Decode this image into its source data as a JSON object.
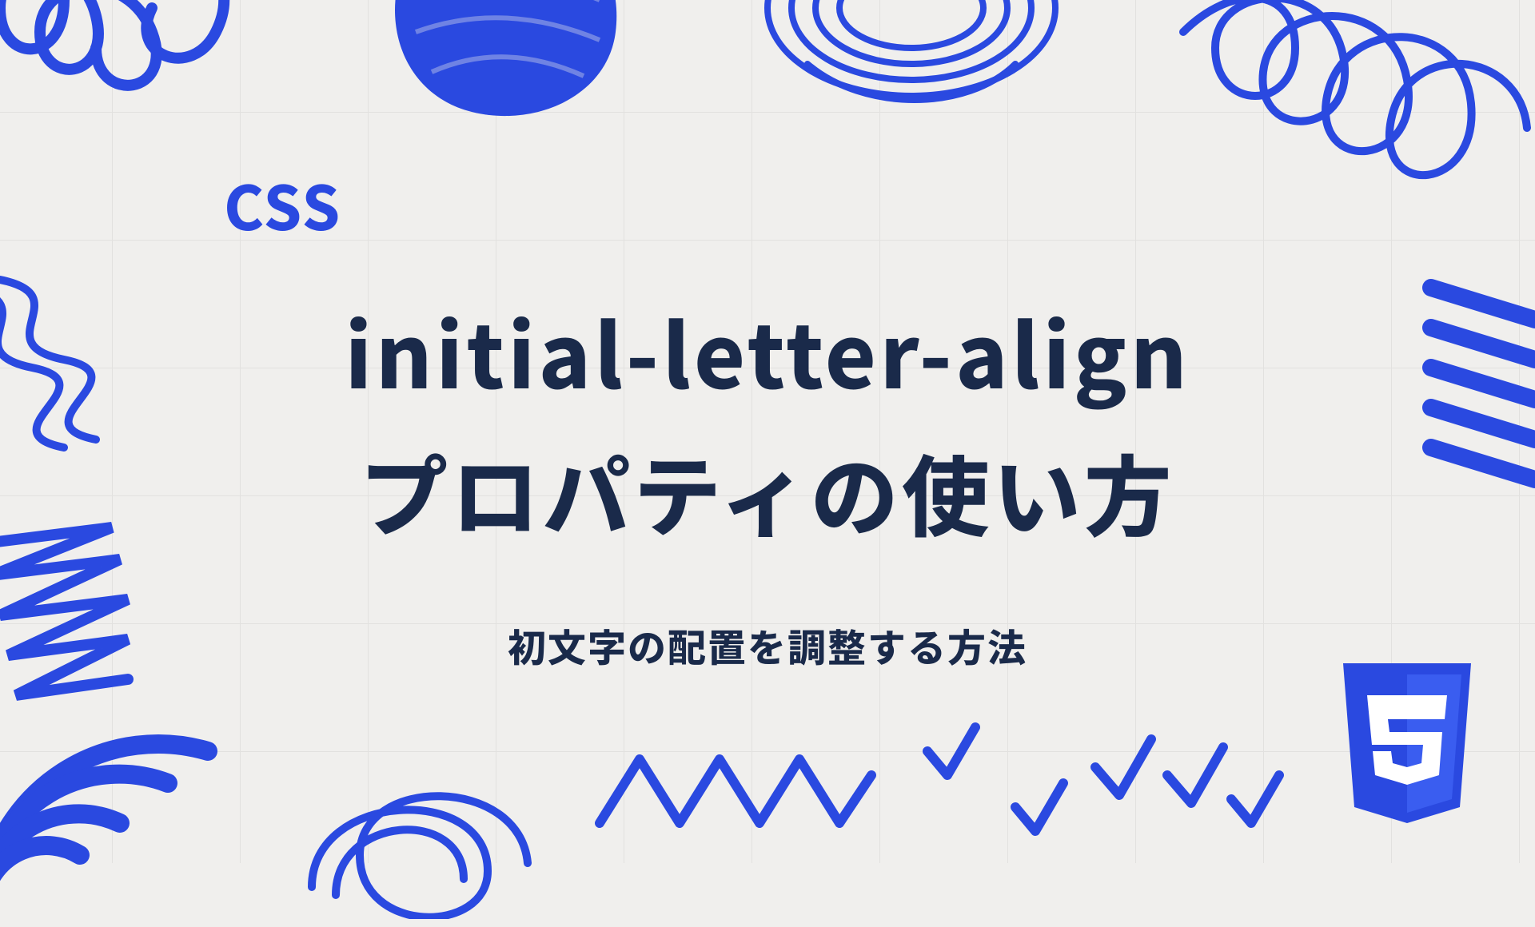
{
  "label": "CSS",
  "title_line1": "initial-letter-align",
  "title_line2": "プロパティの使い方",
  "subtitle": "初文字の配置を調整する方法",
  "logo_name": "css3-logo",
  "colors": {
    "accent": "#2a49e0",
    "text": "#1a2a4a",
    "bg": "#f0efed"
  }
}
